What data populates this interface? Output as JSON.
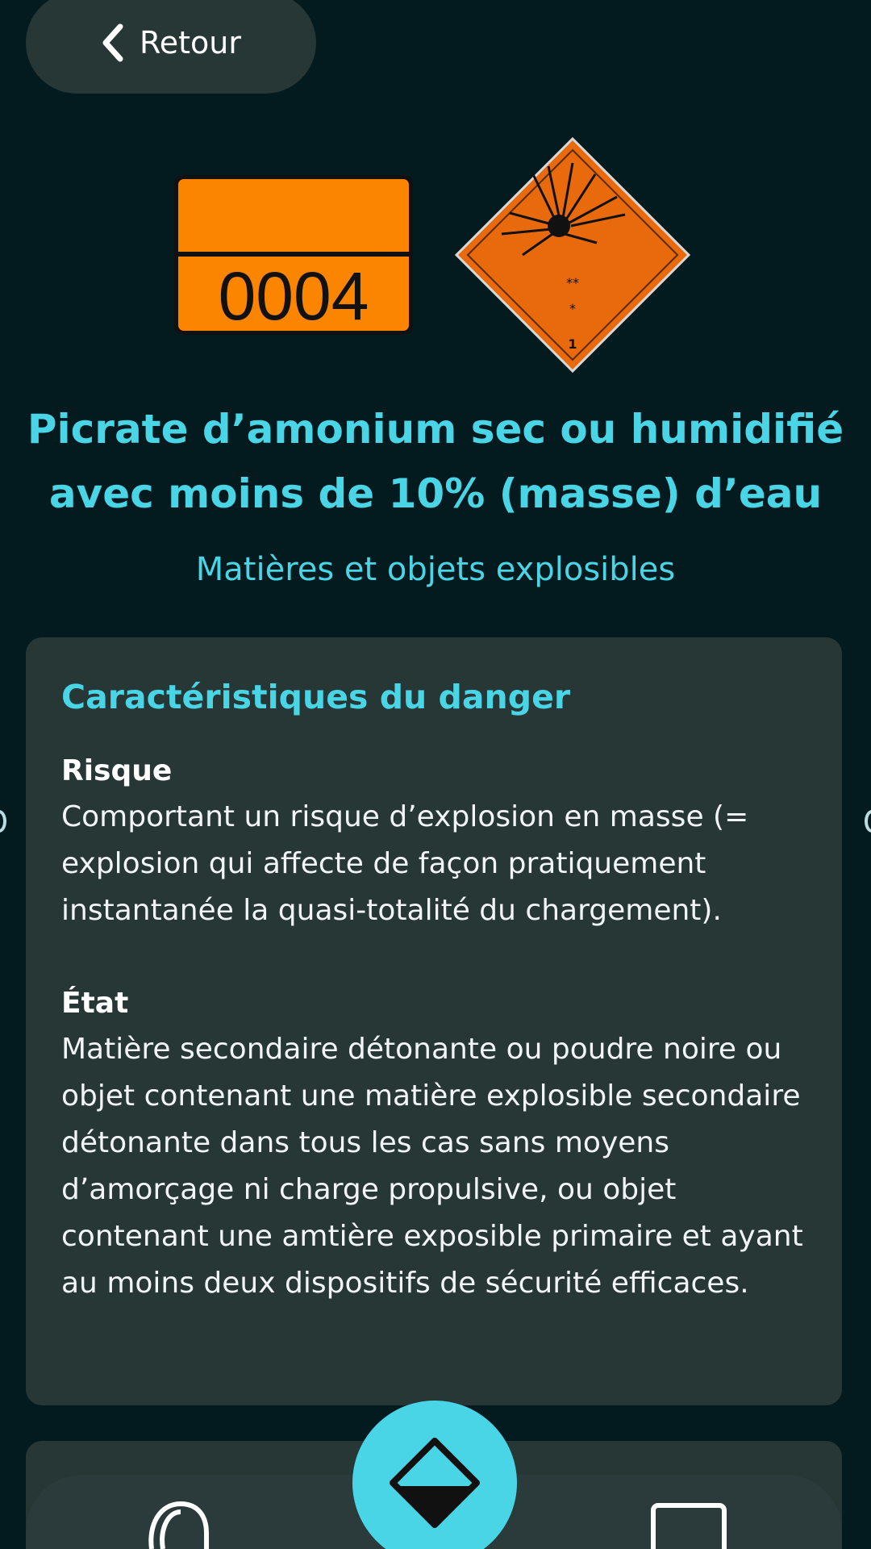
{
  "header": {
    "back_label": "Retour"
  },
  "plate": {
    "number": "0004"
  },
  "hazard_label": {
    "marks_top": "**",
    "marks_mid": "*",
    "class_number": "1",
    "color": "#ec6b0a"
  },
  "title": "Picrate d’amonium sec ou humidifié avec moins de 10% (masse) d’eau",
  "subtitle": "Matières et objets explosibles",
  "card": {
    "title": "Caractéristiques du danger",
    "risk_label": "Risque",
    "risk_text": "Comportant un risque d’explosion en masse (= explosion qui affecte de façon pratiquement instantanée la quasi-totalité du chargement).",
    "state_label": "État",
    "state_text": "Matière secondaire détonante ou poudre noire ou objet contenant une matière explosible secondaire détonante dans tous les cas sans moyens d’amorçage ni charge propulsive, ou objet contenant une amtière exposible primaire et ayant au moins deux dispositifs de sécurité efficaces."
  },
  "colors": {
    "accent": "#4ad5e6",
    "background": "#031a1e",
    "card": "#263736",
    "plate_orange": "#fc8500"
  },
  "icons": {
    "back": "chevron-left-icon",
    "fab": "diamond-icon",
    "nav_left": "search-icon",
    "nav_right": "screen-icon"
  }
}
